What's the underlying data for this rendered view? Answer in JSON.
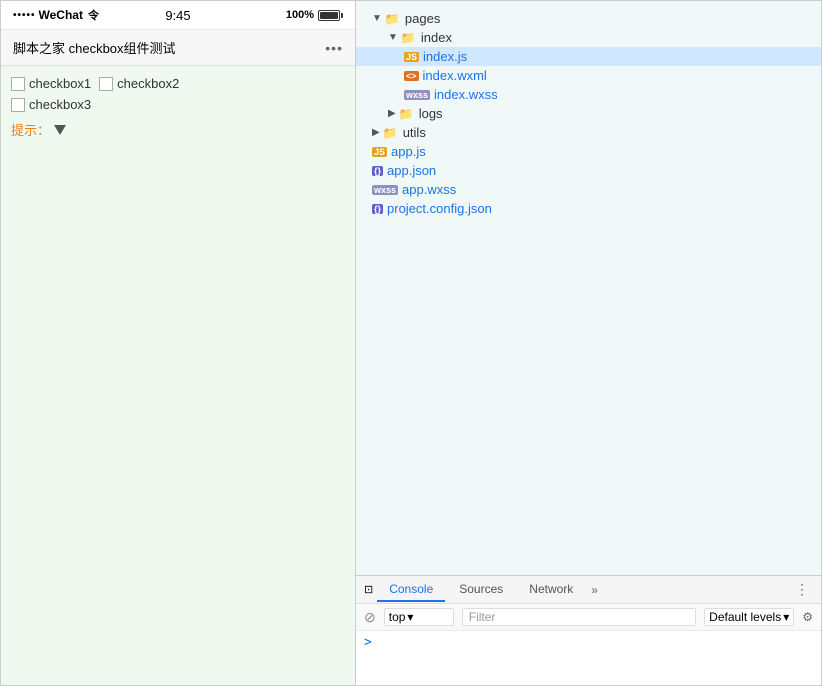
{
  "phone": {
    "status_bar": {
      "dots": "•••••",
      "wechat": "WeChat",
      "wifi": "令",
      "time": "9:45",
      "battery_percent": "100%"
    },
    "nav": {
      "title": "脚本之家 checkbox组件测试",
      "more": "•••"
    },
    "checkboxes": [
      {
        "label": "checkbox1"
      },
      {
        "label": "checkbox2"
      },
      {
        "label": "checkbox3"
      }
    ],
    "hint_label": "提示："
  },
  "file_tree": {
    "items": [
      {
        "indent": 1,
        "type": "folder",
        "expand": true,
        "name": "pages",
        "selected": false
      },
      {
        "indent": 2,
        "type": "folder",
        "expand": true,
        "name": "index",
        "selected": false
      },
      {
        "indent": 3,
        "type": "js",
        "expand": false,
        "name": "index.js",
        "selected": true
      },
      {
        "indent": 3,
        "type": "xml",
        "expand": false,
        "name": "index.wxml",
        "selected": false
      },
      {
        "indent": 3,
        "type": "wxss",
        "expand": false,
        "name": "index.wxss",
        "selected": false
      },
      {
        "indent": 2,
        "type": "folder",
        "expand": false,
        "name": "logs",
        "selected": false
      },
      {
        "indent": 1,
        "type": "folder",
        "expand": false,
        "name": "utils",
        "selected": false
      },
      {
        "indent": 1,
        "type": "js",
        "expand": false,
        "name": "app.js",
        "selected": false
      },
      {
        "indent": 1,
        "type": "json",
        "expand": false,
        "name": "app.json",
        "selected": false
      },
      {
        "indent": 1,
        "type": "wxss",
        "expand": false,
        "name": "app.wxss",
        "selected": false
      },
      {
        "indent": 1,
        "type": "json",
        "expand": false,
        "name": "project.config.json",
        "selected": false
      }
    ]
  },
  "console": {
    "tabs": [
      {
        "label": "Console",
        "active": true
      },
      {
        "label": "Sources",
        "active": false
      },
      {
        "label": "Network",
        "active": false
      }
    ],
    "more_tabs": "»",
    "menu_icon": "⋮",
    "filter_placeholder": "Filter",
    "level_label": "Default levels",
    "top_option": "top",
    "no_entry_symbol": "⊘",
    "prompt": ">"
  }
}
